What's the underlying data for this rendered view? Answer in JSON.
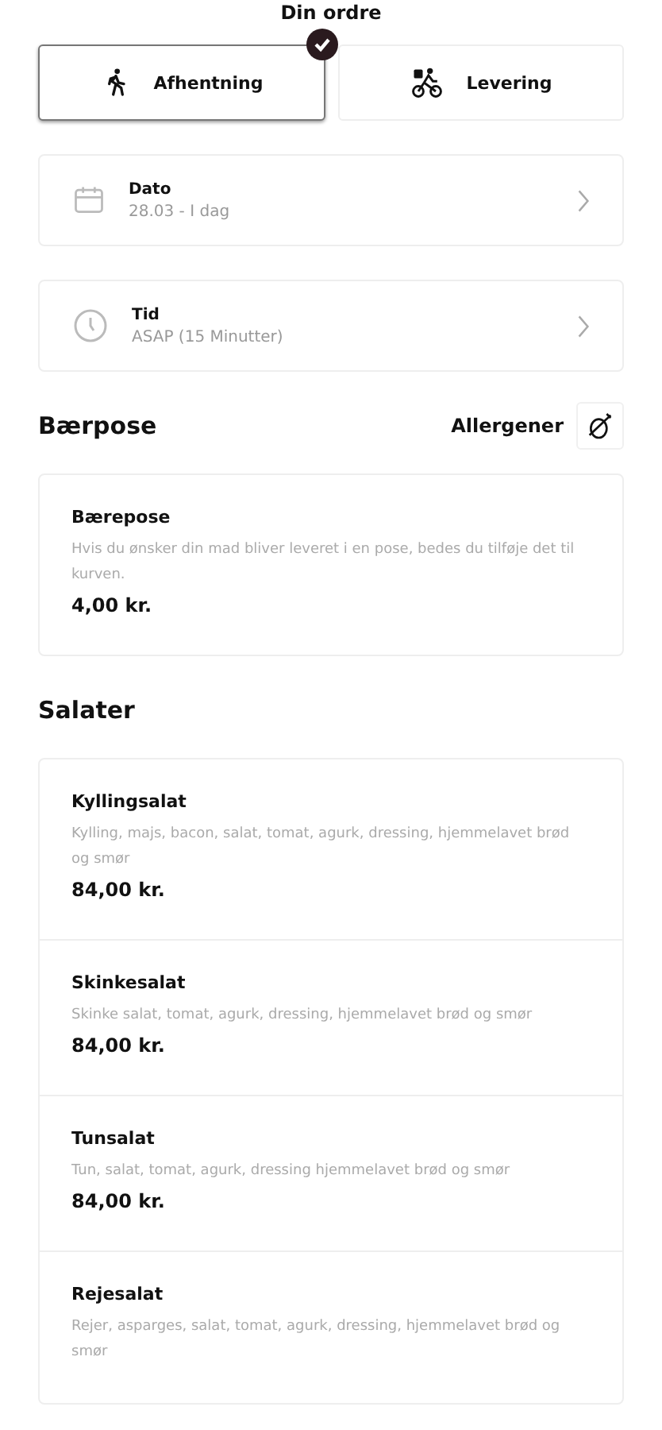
{
  "title": "Din ordre",
  "modes": [
    {
      "label": "Afhentning",
      "kind": "walk",
      "selected": true
    },
    {
      "label": "Levering",
      "kind": "bike",
      "selected": false
    }
  ],
  "pickers": [
    {
      "kind": "date",
      "label": "Dato",
      "value": "28.03 - I dag"
    },
    {
      "kind": "time",
      "label": "Tid",
      "value": "ASAP (15 Minutter)"
    }
  ],
  "allergens_label": "Allergener",
  "sections": [
    {
      "title": "Bærpose",
      "items": [
        {
          "name": "Bærepose",
          "description": "Hvis du ønsker din mad bliver leveret i en pose, bedes du tilføje det til kurven.",
          "price": "4,00 kr."
        }
      ]
    },
    {
      "title": "Salater",
      "items": [
        {
          "name": "Kyllingsalat",
          "description": "Kylling, majs, bacon, salat, tomat, agurk, dressing, hjemmelavet brød og smør",
          "price": "84,00 kr."
        },
        {
          "name": "Skinkesalat",
          "description": "Skinke salat, tomat, agurk, dressing, hjemmelavet brød og smør",
          "price": "84,00 kr."
        },
        {
          "name": "Tunsalat",
          "description": "Tun, salat, tomat, agurk, dressing hjemmelavet brød og smør",
          "price": "84,00 kr."
        },
        {
          "name": "Rejesalat",
          "description": "Rejer, asparges, salat, tomat, agurk, dressing, hjemmelavet brød og smør"
        }
      ]
    }
  ]
}
